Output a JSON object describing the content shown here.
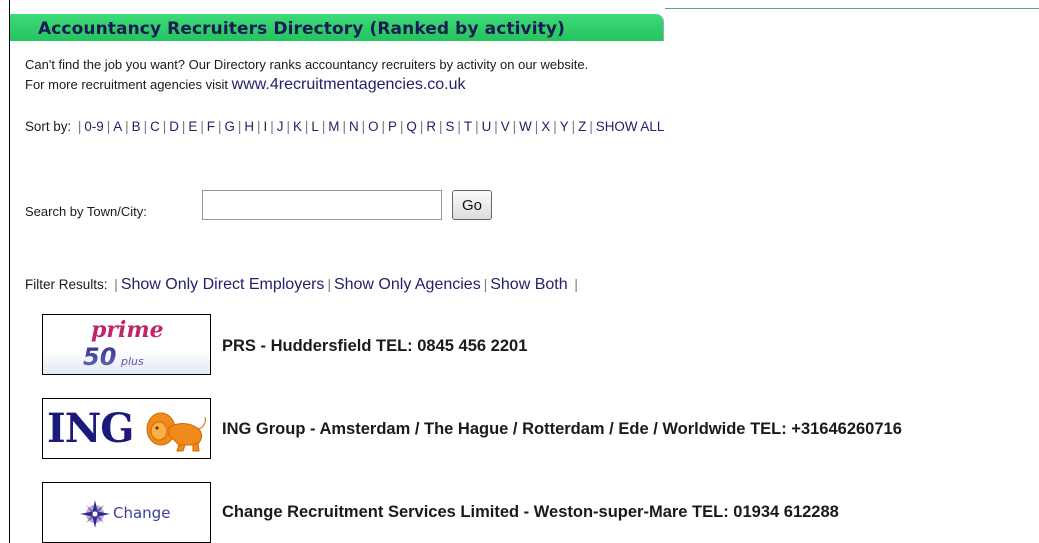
{
  "header": {
    "title": "Accountancy Recruiters Directory (Ranked by activity)"
  },
  "intro": {
    "line1": "Can't find the job you want? Our Directory ranks accountancy recruiters by activity on our website.",
    "line2_prefix": "For more recruitment agencies visit",
    "link": "www.4recruitmentagencies.co.uk"
  },
  "sort": {
    "label": "Sort by:",
    "options": [
      "0-9",
      "A",
      "B",
      "C",
      "D",
      "E",
      "F",
      "G",
      "H",
      "I",
      "J",
      "K",
      "L",
      "M",
      "N",
      "O",
      "P",
      "Q",
      "R",
      "S",
      "T",
      "U",
      "V",
      "W",
      "X",
      "Y",
      "Z",
      "SHOW ALL"
    ]
  },
  "search": {
    "label": "Search by Town/City:",
    "value": "",
    "placeholder": "",
    "button": "Go"
  },
  "filter": {
    "label": "Filter Results:",
    "options": [
      "Show Only Direct Employers",
      "Show Only Agencies",
      "Show Both"
    ]
  },
  "entries": [
    {
      "text": "PRS - Huddersfield  TEL: 0845 456 2201",
      "logo": {
        "line1": "prime",
        "line2": "50",
        "line3": "plus"
      }
    },
    {
      "text": "ING Group - Amsterdam / The Hague / Rotterdam / Ede / Worldwide  TEL: +31646260716",
      "logo": {
        "word": "ING",
        "icon": "lion-icon"
      }
    },
    {
      "text": "Change Recruitment Services Limited - Weston-super-Mare  TEL: 01934 612288",
      "logo": {
        "word": "Change",
        "icon": "compass-star-icon"
      }
    }
  ],
  "colors": {
    "tab_green": "#24c45e",
    "title_navy": "#1a1a55",
    "link_navy": "#22226a"
  }
}
